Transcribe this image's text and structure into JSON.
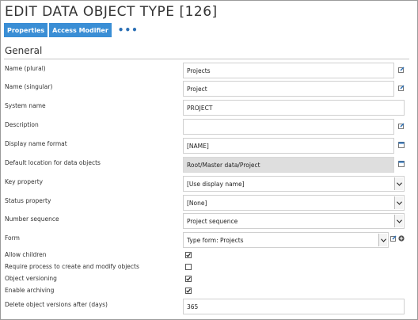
{
  "page": {
    "title": "EDIT DATA OBJECT TYPE [126]"
  },
  "toolbar": {
    "properties_label": "Properties",
    "access_modifier_label": "Access Modifier",
    "more_label": "•••"
  },
  "section": {
    "title": "General"
  },
  "fields": {
    "name_plural": {
      "label": "Name (plural)",
      "value": "Projects"
    },
    "name_singular": {
      "label": "Name (singular)",
      "value": "Project"
    },
    "system_name": {
      "label": "System name",
      "value": "PROJECT"
    },
    "description": {
      "label": "Description",
      "value": ""
    },
    "display_name_format": {
      "label": "Display name format",
      "value": "[NAME]"
    },
    "default_location": {
      "label": "Default location for data objects",
      "value": "Root/Master data/Project"
    },
    "key_property": {
      "label": "Key property",
      "value": "[Use display name]"
    },
    "status_property": {
      "label": "Status property",
      "value": "[None]"
    },
    "number_sequence": {
      "label": "Number sequence",
      "value": "Project sequence"
    },
    "form": {
      "label": "Form",
      "value": "Type form: Projects"
    },
    "allow_children": {
      "label": "Allow children",
      "checked": true
    },
    "require_process": {
      "label": "Require process to create and modify objects",
      "checked": false
    },
    "object_versioning": {
      "label": "Object versioning",
      "checked": true
    },
    "enable_archiving": {
      "label": "Enable archiving",
      "checked": true
    },
    "delete_versions_after": {
      "label": "Delete object versions after (days)",
      "value": "365"
    }
  },
  "colors": {
    "accent": "#3a8ed5",
    "link": "#2a6fb5",
    "readonly_bg": "#dedede"
  }
}
